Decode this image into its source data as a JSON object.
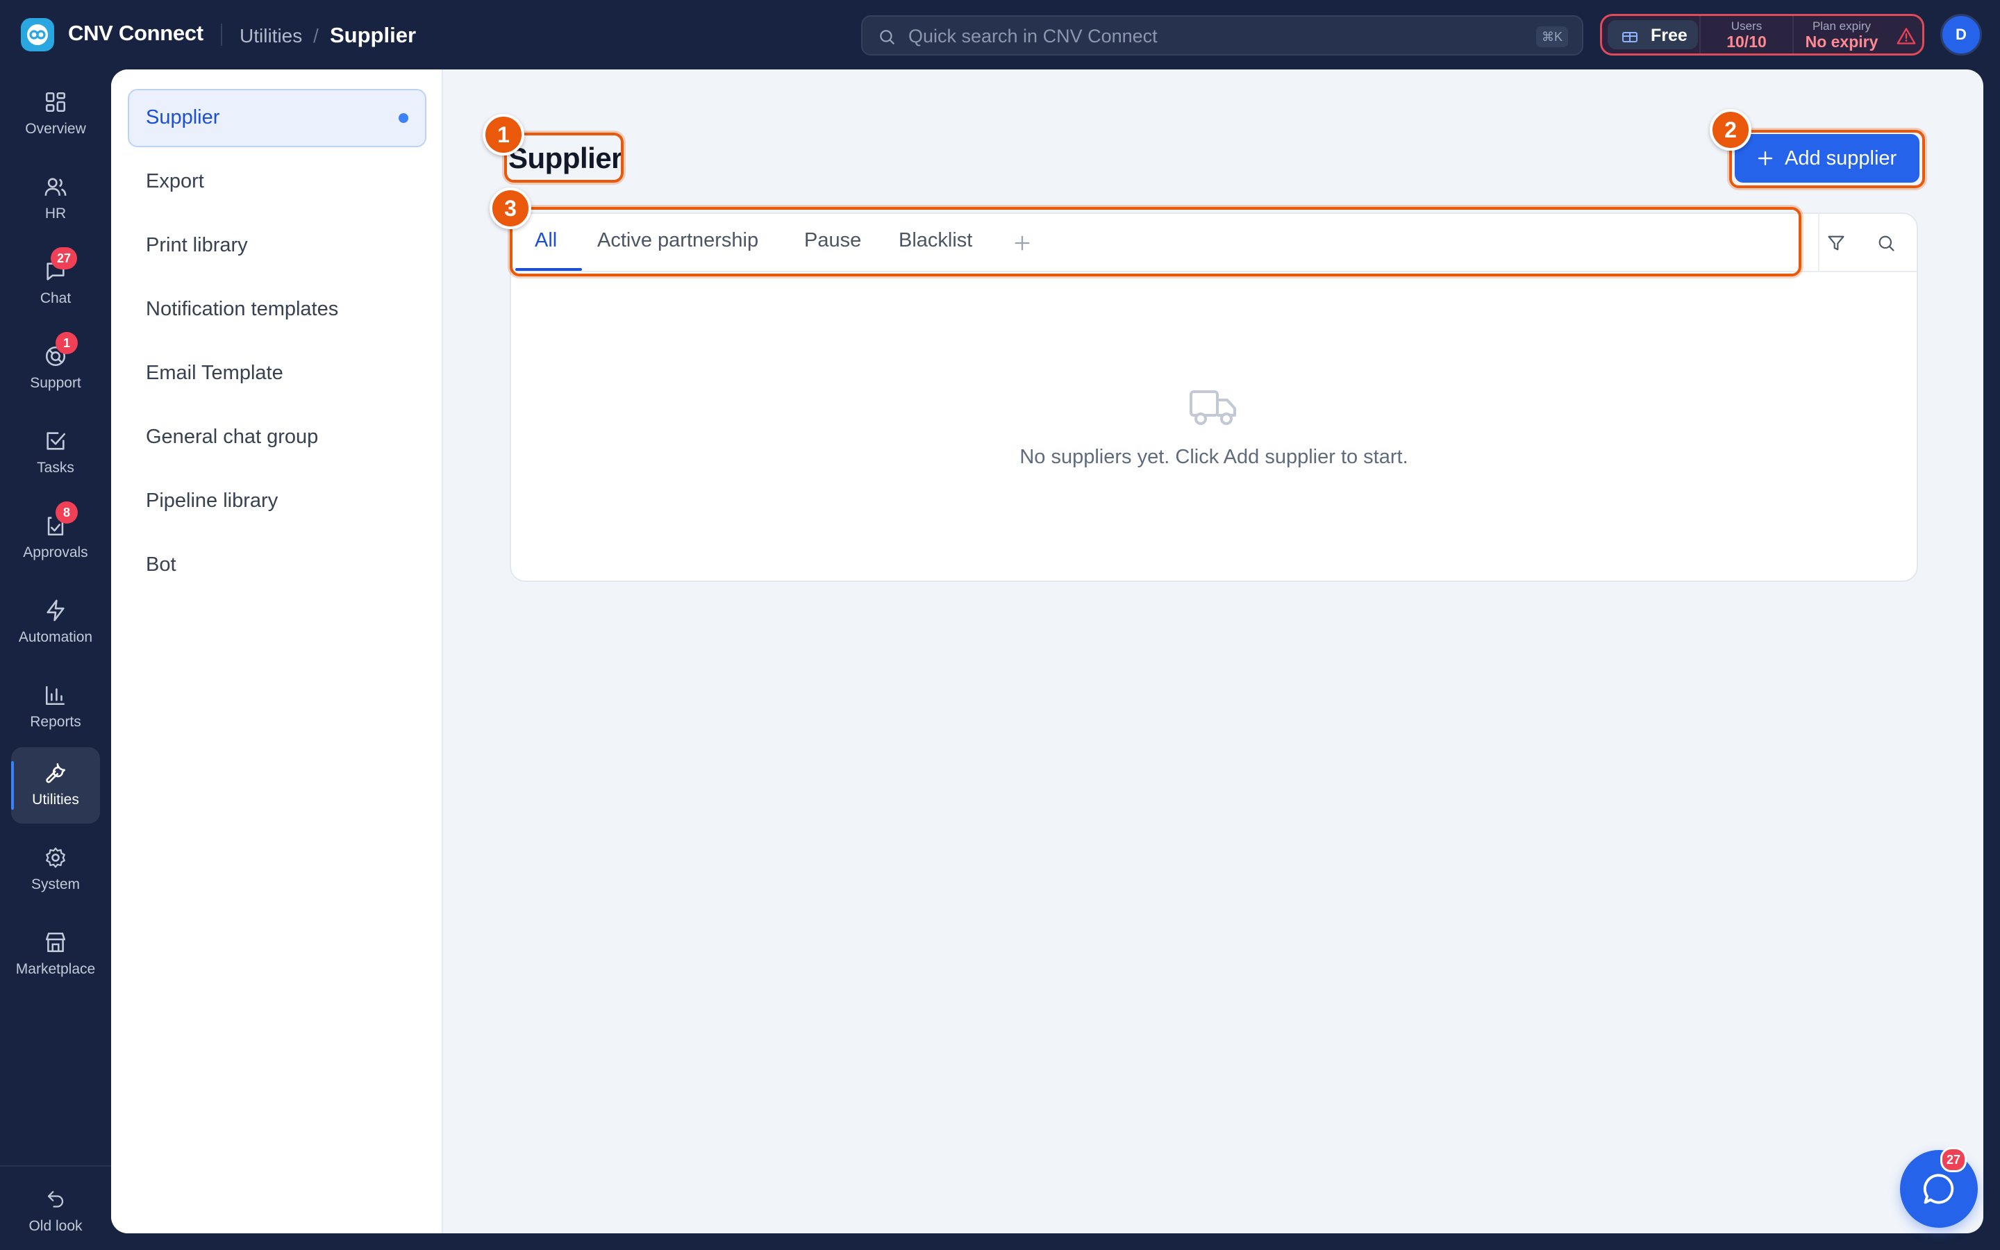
{
  "app": {
    "name": "CNV Connect",
    "breadcrumb": [
      "Utilities",
      "Supplier"
    ],
    "breadcrumb_sep": "/"
  },
  "search": {
    "placeholder": "Quick search in CNV Connect",
    "shortcut": "⌘K"
  },
  "plan": {
    "tier": "Free",
    "users_label": "Users",
    "users_value": "10/10",
    "expiry_label": "Plan expiry",
    "expiry_value": "No expiry",
    "alert_color": "#ef4056"
  },
  "user": {
    "avatar_initial": "D"
  },
  "rail": {
    "items": [
      {
        "label": "Overview",
        "icon": "grid-icon"
      },
      {
        "label": "HR",
        "icon": "users-icon"
      },
      {
        "label": "Chat",
        "icon": "chat-icon",
        "badge": "27"
      },
      {
        "label": "Support",
        "icon": "lifebuoy-icon",
        "badge": "1"
      },
      {
        "label": "Tasks",
        "icon": "checkbox-icon"
      },
      {
        "label": "Approvals",
        "icon": "approval-icon",
        "badge": "8"
      },
      {
        "label": "Automation",
        "icon": "lightning-icon"
      },
      {
        "label": "Reports",
        "icon": "bar-chart-icon"
      },
      {
        "label": "Utilities",
        "icon": "wrench-icon",
        "active": true
      },
      {
        "label": "System",
        "icon": "gear-icon"
      },
      {
        "label": "Marketplace",
        "icon": "store-icon"
      }
    ],
    "bottom_label": "Old look"
  },
  "subnav": {
    "items": [
      {
        "label": "Supplier",
        "active": true
      },
      {
        "label": "Export"
      },
      {
        "label": "Print library"
      },
      {
        "label": "Notification templates"
      },
      {
        "label": "Email Template"
      },
      {
        "label": "General chat group"
      },
      {
        "label": "Pipeline library"
      },
      {
        "label": "Bot"
      }
    ]
  },
  "page": {
    "title": "Supplier",
    "add_button": "Add supplier",
    "tabs": [
      "All",
      "Active partnership",
      "Pause",
      "Blacklist"
    ],
    "active_tab": "All",
    "empty_message": "No suppliers yet. Click Add supplier to start."
  },
  "annotations": [
    "1",
    "2",
    "3"
  ],
  "floating_chat": {
    "badge": "27"
  },
  "colors": {
    "accent": "#2563eb",
    "sidebar_bg": "#172340",
    "annotation": "#ea580c",
    "badge": "#ef4056"
  }
}
